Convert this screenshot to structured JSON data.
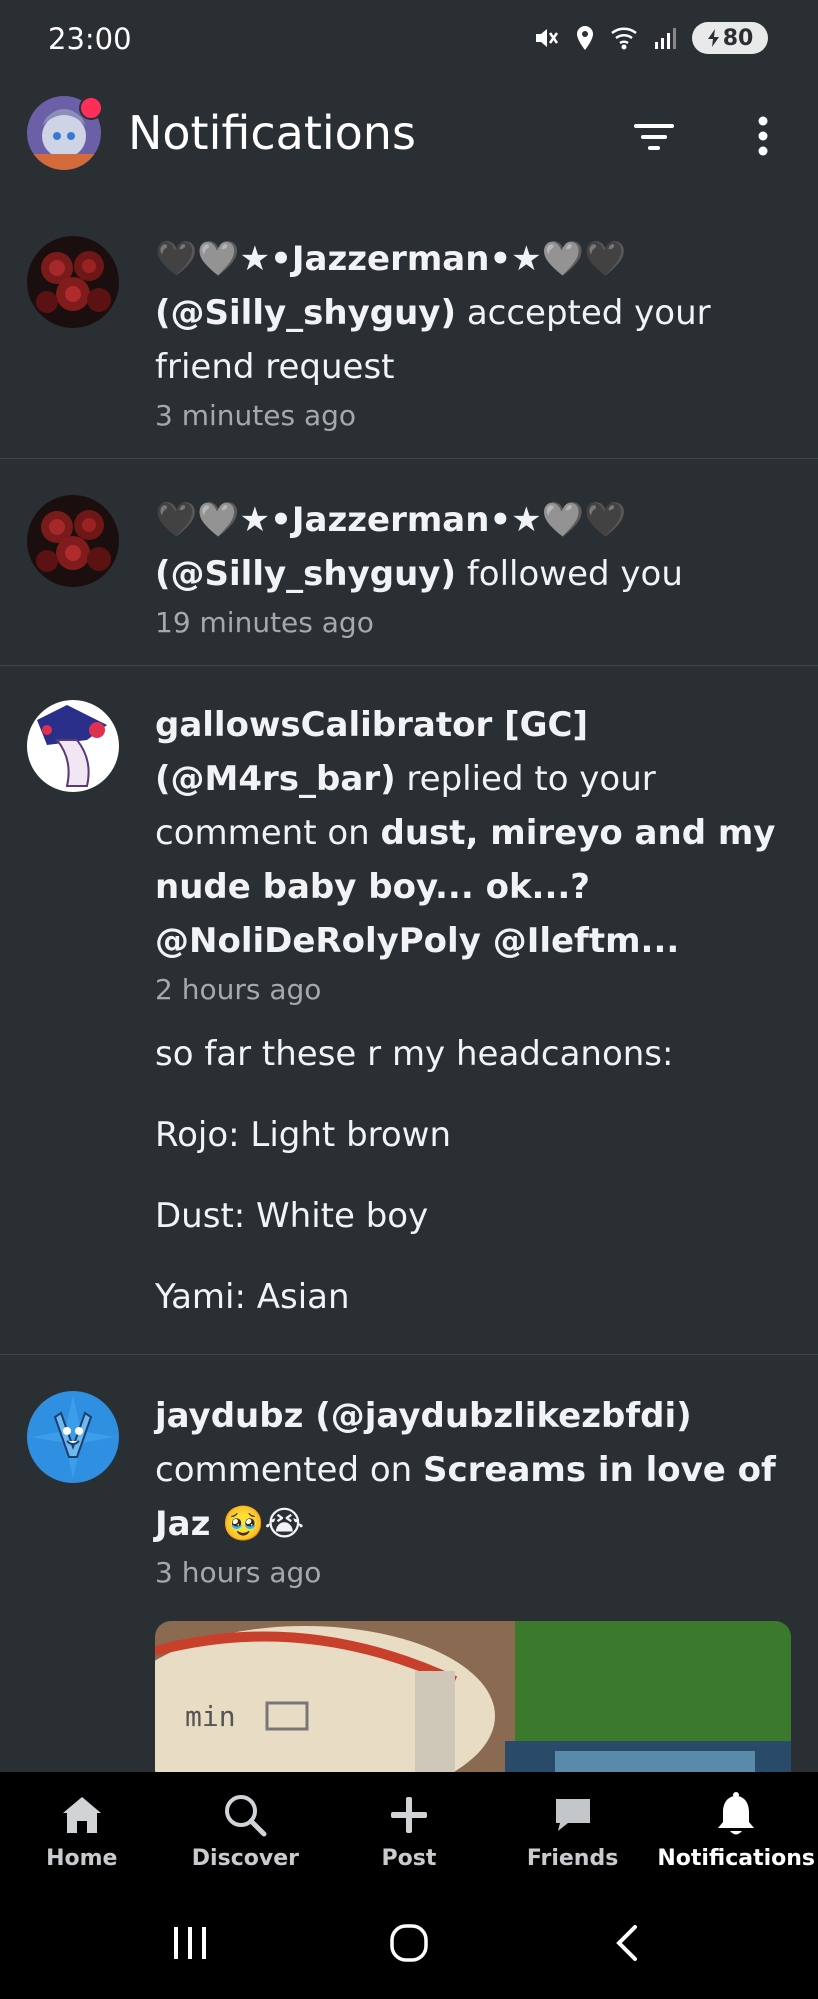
{
  "status_bar": {
    "time": "23:00",
    "battery": "80"
  },
  "header": {
    "title": "Notifications"
  },
  "notifications": [
    {
      "name_line": "🖤🩶★•Jazzerman•★🩶🖤",
      "handle": "(@Silly_shyguy)",
      "action": " accepted your friend request",
      "time": "3 minutes ago"
    },
    {
      "name_line": "🖤🩶★•Jazzerman•★🩶🖤",
      "handle": "(@Silly_shyguy)",
      "action": " followed you",
      "time": "19 minutes ago"
    },
    {
      "name_line": "gallowsCalibrator [GC]",
      "handle": "(@M4rs_bar)",
      "action": " replied to your comment on ",
      "target": "dust, mireyo and my nude baby boy... ok...? @NoliDeRolyPoly @Ileftm...",
      "time": "2 hours ago",
      "comment": [
        "so far these r my headcanons:",
        "Rojo: Light brown",
        "Dust: White boy",
        "Yami: Asian"
      ]
    },
    {
      "name_line": "jaydubz (@jaydubzlikezbfdi)",
      "action": "commented on ",
      "target": "Screams in love of Jaz 🥹😭",
      "time": "3 hours ago",
      "thumb_text": "min"
    }
  ],
  "bottom_nav": {
    "items": [
      {
        "label": "Home",
        "icon": "home-icon"
      },
      {
        "label": "Discover",
        "icon": "search-icon"
      },
      {
        "label": "Post",
        "icon": "plus-icon"
      },
      {
        "label": "Friends",
        "icon": "chat-icon"
      },
      {
        "label": "Notifications",
        "icon": "bell-icon"
      }
    ],
    "active": "Notifications"
  },
  "system_nav": [
    "recents-icon",
    "home-circle-icon",
    "back-icon"
  ],
  "colors": {
    "background": "#2a2f33",
    "notif_dot": "#ff2f5a",
    "muted_text": "#a3a9ad"
  }
}
